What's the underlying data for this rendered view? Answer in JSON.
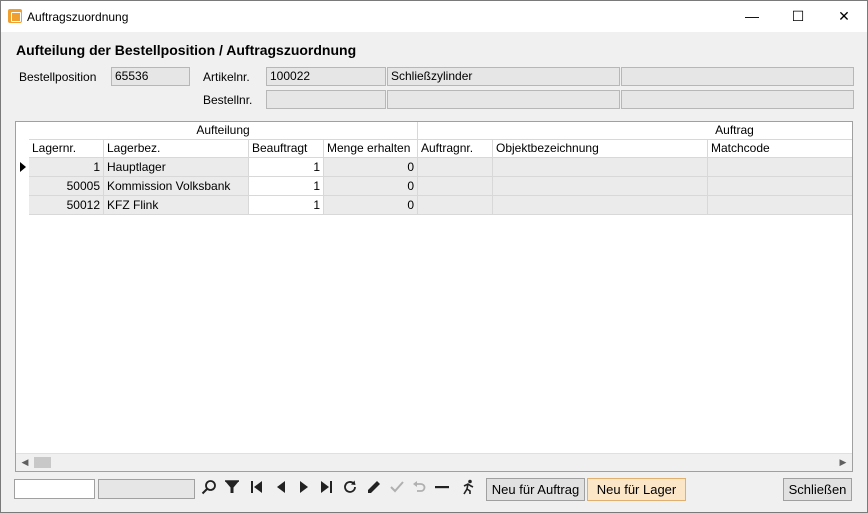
{
  "window": {
    "title": "Auftragszuordnung",
    "minimize": "—",
    "maximize": "☐",
    "close": "✕"
  },
  "header": {
    "title": "Aufteilung der Bestellposition / Auftragszuordnung"
  },
  "form": {
    "bestellposition_label": "Bestellposition",
    "bestellposition_value": "65536",
    "artikelnr_label": "Artikelnr.",
    "artikelnr_value": "100022",
    "artikel_name": "Schließzylinder",
    "artikel_extra": "",
    "bestellnr_label": "Bestellnr.",
    "bestellnr_value": "",
    "bestellnr_extra1": "",
    "bestellnr_extra2": ""
  },
  "grid": {
    "groups": {
      "aufteilung": "Aufteilung",
      "auftrag": "Auftrag"
    },
    "columns": [
      "Lagernr.",
      "Lagerbez.",
      "Beauftragt",
      "Menge erhalten",
      "Auftragnr.",
      "Objektbezeichnung",
      "Matchcode"
    ],
    "rows": [
      [
        "1",
        "Hauptlager",
        "1",
        "0",
        "",
        "",
        ""
      ],
      [
        "50005",
        "Kommission Volksbank",
        "1",
        "0",
        "",
        "",
        ""
      ],
      [
        "50012",
        "KFZ Flink",
        "1",
        "0",
        "",
        "",
        ""
      ]
    ]
  },
  "toolbar": {
    "search_value": "",
    "filter_value": "",
    "icons": [
      "search-icon",
      "filter-icon",
      "first-record-icon",
      "prev-record-icon",
      "next-record-icon",
      "last-record-icon",
      "refresh-icon",
      "edit-icon",
      "confirm-icon",
      "undo-icon",
      "delete-icon",
      "run-icon"
    ],
    "neu_auftrag": "Neu für Auftrag",
    "neu_lager": "Neu für Lager",
    "schliessen": "Schließen"
  },
  "colors": {
    "accent_button": "#fbe6c8",
    "app_icon": "#f0a030"
  }
}
